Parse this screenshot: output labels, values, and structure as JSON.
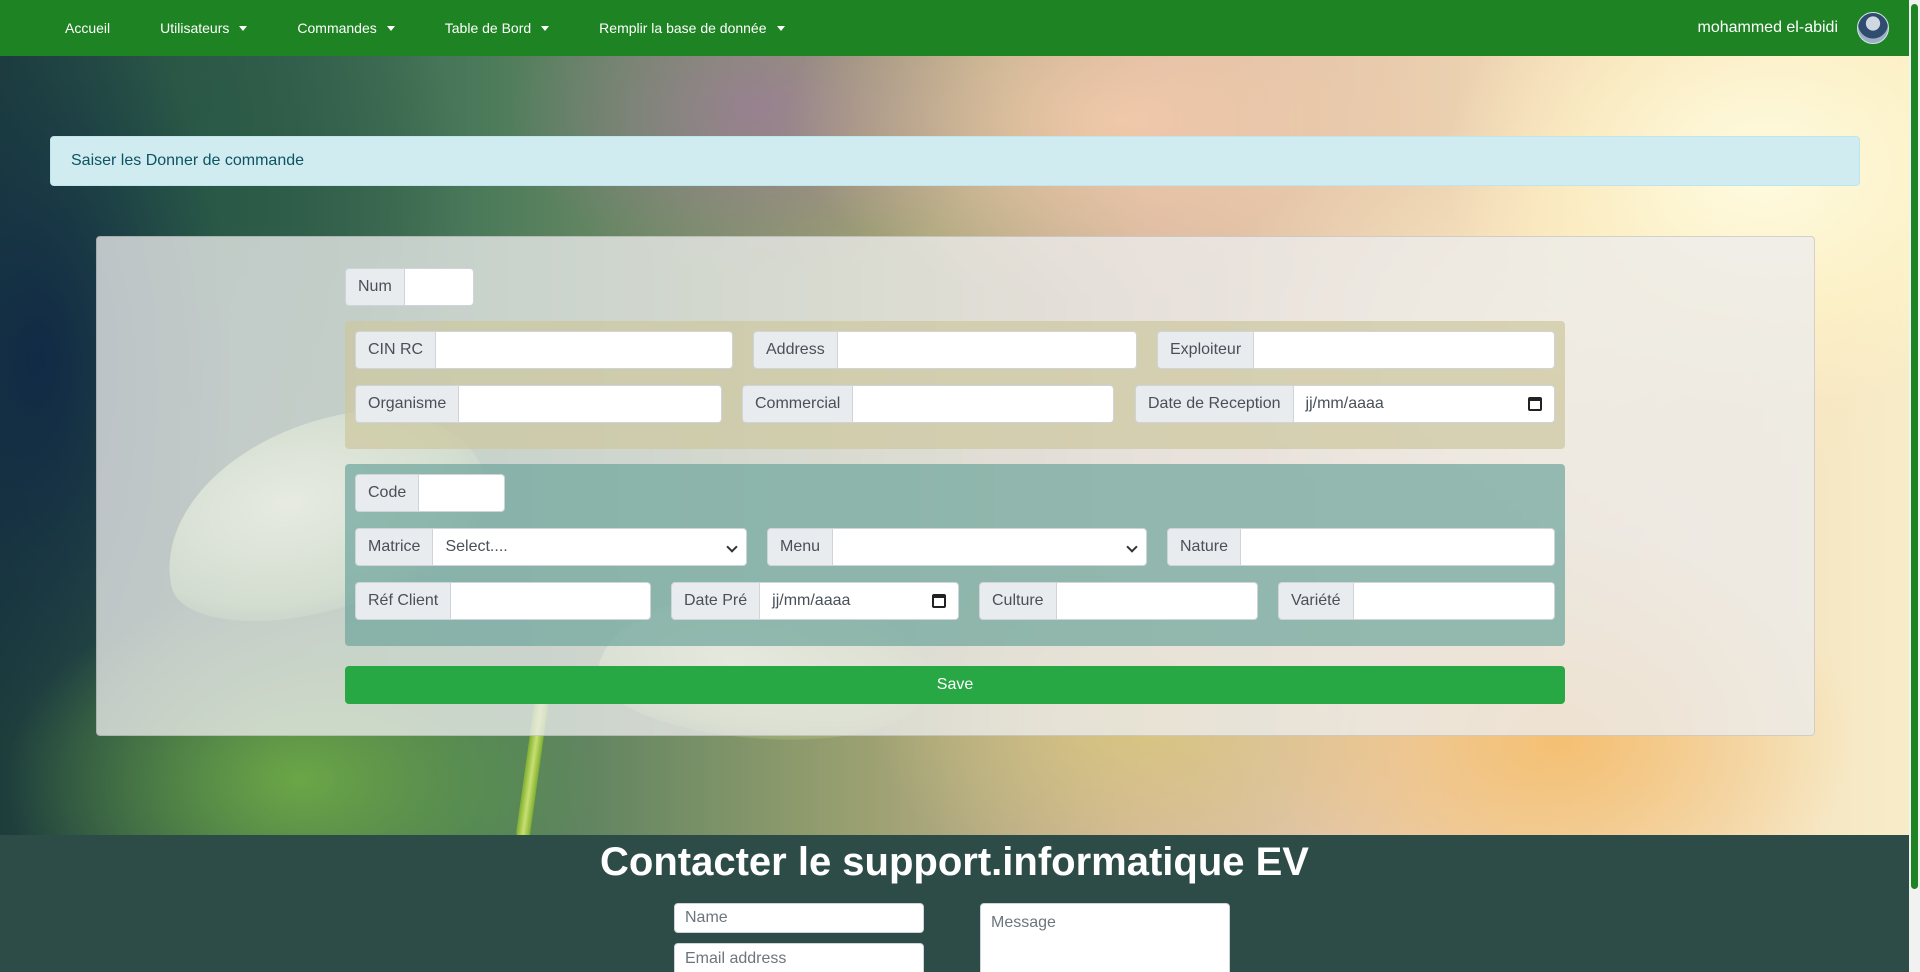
{
  "navbar": {
    "items": [
      {
        "label": "Accueil",
        "dropdown": false
      },
      {
        "label": "Utilisateurs",
        "dropdown": true
      },
      {
        "label": "Commandes",
        "dropdown": true
      },
      {
        "label": "Table de Bord",
        "dropdown": true
      },
      {
        "label": "Remplir la base de donnée",
        "dropdown": true
      }
    ],
    "user_name": "mohammed el-abidi"
  },
  "alert": {
    "text": "Saiser les Donner de commande"
  },
  "form": {
    "num": {
      "label": "Num",
      "value": ""
    },
    "cin_rc": {
      "label": "CIN RC",
      "value": ""
    },
    "address": {
      "label": "Address",
      "value": ""
    },
    "exploiteur": {
      "label": "Exploiteur",
      "value": ""
    },
    "organisme": {
      "label": "Organisme",
      "value": ""
    },
    "commercial": {
      "label": "Commercial",
      "value": ""
    },
    "date_reception": {
      "label": "Date de Reception",
      "value": "jj/mm/aaaa"
    },
    "code": {
      "label": "Code",
      "value": ""
    },
    "matrice": {
      "label": "Matrice",
      "value": "Select...."
    },
    "menu": {
      "label": "Menu",
      "value": ""
    },
    "nature": {
      "label": "Nature",
      "value": ""
    },
    "ref_client": {
      "label": "Réf Client",
      "value": ""
    },
    "date_pre": {
      "label": "Date Pré",
      "value": "jj/mm/aaaa"
    },
    "culture": {
      "label": "Culture",
      "value": ""
    },
    "variete": {
      "label": "Variété",
      "value": ""
    },
    "save_label": "Save"
  },
  "footer": {
    "title": "Contacter le support.informatique EV",
    "name_placeholder": "Name",
    "email_placeholder": "Email address",
    "message_placeholder": "Message"
  },
  "colors": {
    "navbar": "#1e8423",
    "save_button": "#28a745",
    "alert_bg": "#d1ecf1",
    "footer_bg": "#2e4c47"
  }
}
